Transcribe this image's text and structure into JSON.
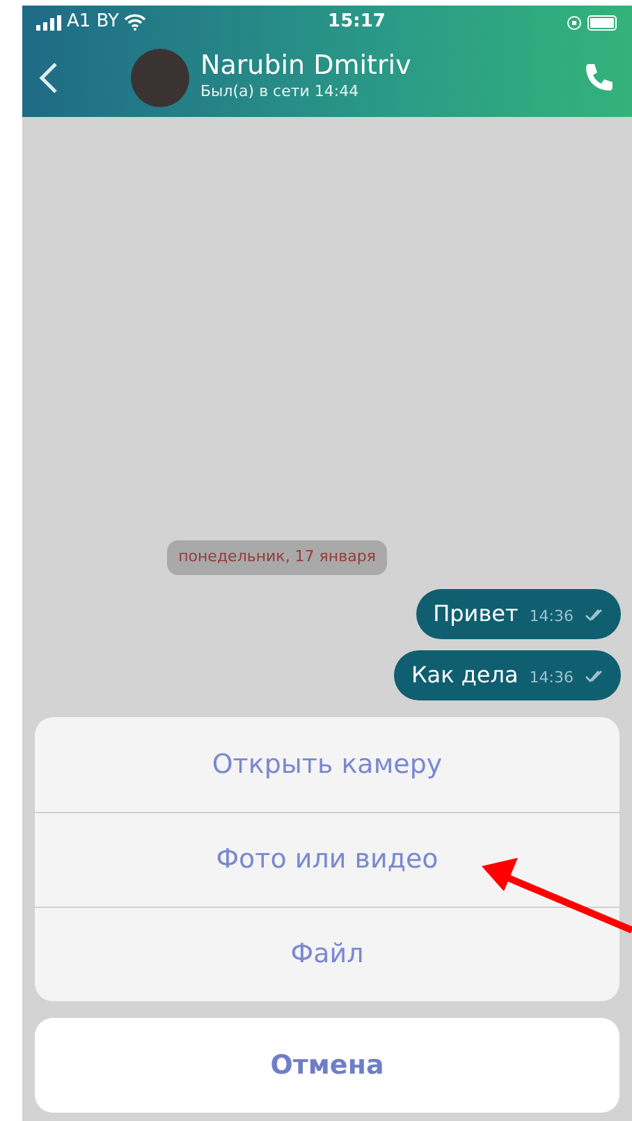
{
  "status_bar": {
    "carrier": "A1 BY",
    "time": "15:17"
  },
  "header": {
    "name": "Narubin Dmitriv",
    "last_seen": "Был(а) в сети 14:44"
  },
  "date_separator": "понедельник, 17 января",
  "messages": [
    {
      "text": "Привет",
      "time": "14:36",
      "read": true
    },
    {
      "text": "Как дела",
      "time": "14:36",
      "read": true
    }
  ],
  "action_sheet": {
    "options": [
      "Открыть камеру",
      "Фото или видео",
      "Файл"
    ],
    "cancel": "Отмена"
  }
}
